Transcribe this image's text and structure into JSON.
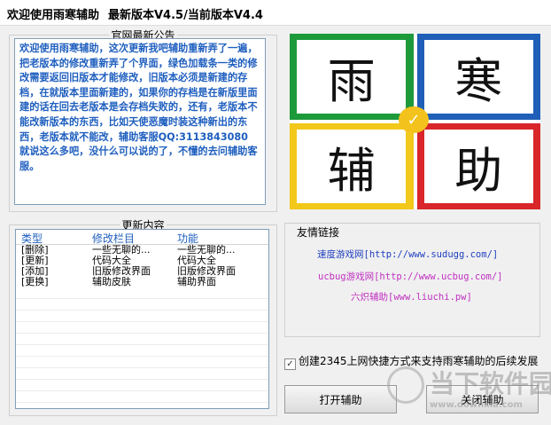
{
  "window": {
    "title": "欢迎使用雨寒辅助",
    "version": "最新版本V4.5/当前版本V4.4"
  },
  "notice": {
    "legend": "官网最新公告",
    "text": " 欢迎使用雨寒辅助，这次更新我吧辅助重新弄了一遍，把老版本的修改重新弄了个界面，绿色加载条一类的修改需要返回旧版本才能修改，旧版本必须是新建的存档，在就版本里面新建的，如果你的存档是在新版里面建的话在回去老版本是会存档失败的，还有，老版本不能改新版本的东西，比如天使恶魔时装这种新出的东西，老版本就不能改，辅助客服QQ:3113843080 就说这么多吧，没什么可以说的了，不懂的去问辅助客服。"
  },
  "changes": {
    "legend": "更新内容",
    "columns": [
      "类型",
      "修改栏目",
      "功能"
    ],
    "rows": [
      [
        "[删除]",
        "一些无聊的...",
        "一些无聊的..."
      ],
      [
        "[更新]",
        "代码大全",
        "代码大全"
      ],
      [
        "[添加]",
        "旧版修改界面",
        "旧版修改界面"
      ],
      [
        "[更换]",
        "辅助皮肤",
        "辅助界面"
      ]
    ]
  },
  "logo": {
    "chars": [
      "雨",
      "寒",
      "辅",
      "助"
    ],
    "colors": {
      "green": "#1d9a3a",
      "blue": "#1f5fb8",
      "yellow": "#f2c81a",
      "red": "#d8262a"
    }
  },
  "links": {
    "title": "友情链接",
    "items": [
      {
        "text": "速度游戏网[http://www.sudugg.com/]",
        "color": "#1f3fbf"
      },
      {
        "text": "ucbug游戏网[http://www.ucbug.com/]",
        "color": "#c030c0"
      },
      {
        "text": "六炽辅助[www.liuchi.pw]",
        "color": "#c030c0"
      }
    ]
  },
  "checkbox": {
    "label": "创建2345上网快捷方式来支持雨寒辅助的后续发展",
    "checked": true
  },
  "buttons": {
    "open": "打开辅助",
    "close": "关闭辅助"
  },
  "watermark": {
    "text": "当下软件园",
    "sub": "www.downxia.com"
  }
}
